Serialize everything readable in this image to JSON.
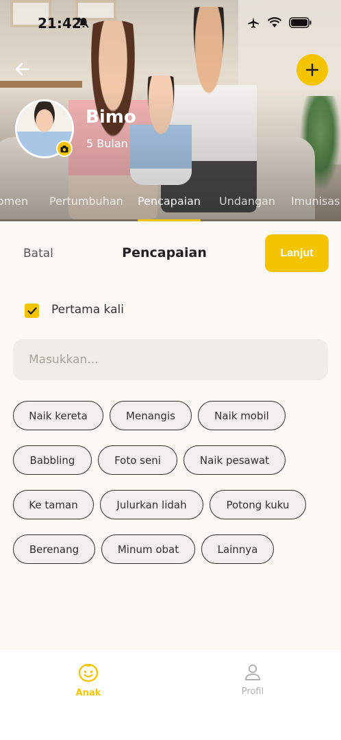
{
  "status_bar": {
    "time": "21:42"
  },
  "profile": {
    "name": "Bimo",
    "age": "5 Bulan"
  },
  "tabs": [
    {
      "label": "Momen"
    },
    {
      "label": "Pertumbuhan"
    },
    {
      "label": "Pencapaian"
    },
    {
      "label": "Undangan"
    },
    {
      "label": "Imunisasi"
    }
  ],
  "sheet": {
    "cancel_label": "Batal",
    "title": "Pencapaian",
    "next_label": "Lanjut",
    "first_time_label": "Pertama kali",
    "first_time_checked": true,
    "input_placeholder": "Masukkan..."
  },
  "chips": [
    "Naik kereta",
    "Menangis",
    "Naik mobil",
    "Babbling",
    "Foto seni",
    "Naik pesawat",
    "Ke taman",
    "Julurkan lidah",
    "Potong kuku",
    "Berenang",
    "Minum obat",
    "Lainnya"
  ],
  "bottom_nav": [
    {
      "label": "Anak",
      "icon": "smiley-face-icon",
      "active": true
    },
    {
      "label": "Profil",
      "icon": "person-icon",
      "active": false
    }
  ],
  "colors": {
    "accent": "#f5c400",
    "background": "#fbf9f4"
  }
}
